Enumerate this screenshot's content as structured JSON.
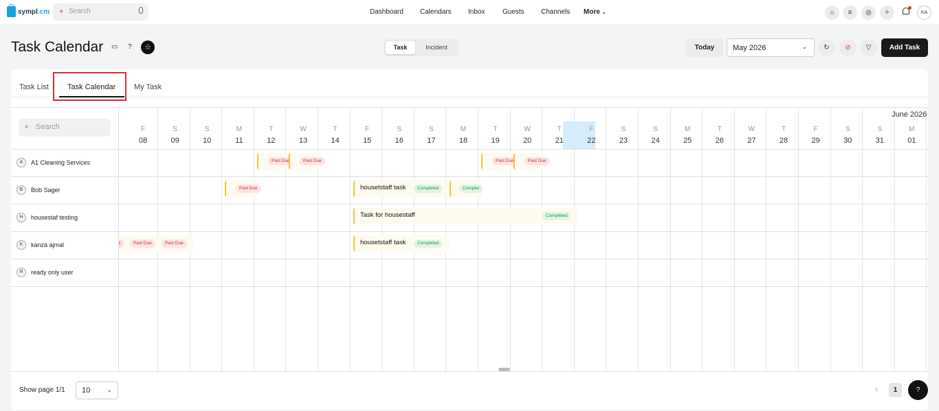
{
  "topbar": {
    "logo_text": "sympl",
    "logo_text2": ".cm",
    "search_placeholder": "Search",
    "nav": [
      "Dashboard",
      "Calendars",
      "Inbox",
      "Guests",
      "Channels",
      "More"
    ],
    "user_initials": "KA"
  },
  "header": {
    "title": "Task Calendar",
    "segments": [
      "Task",
      "Incident"
    ],
    "today_label": "Today",
    "month_value": "May 2026",
    "add_task_label": "Add Task"
  },
  "tabs": [
    "Task List",
    "Task Calendar",
    "My Task"
  ],
  "grid": {
    "search_placeholder": "Search",
    "next_month_label": "June 2026",
    "days": [
      {
        "l": "F",
        "n": "08"
      },
      {
        "l": "S",
        "n": "09"
      },
      {
        "l": "S",
        "n": "10"
      },
      {
        "l": "M",
        "n": "11"
      },
      {
        "l": "T",
        "n": "12"
      },
      {
        "l": "W",
        "n": "13"
      },
      {
        "l": "T",
        "n": "14"
      },
      {
        "l": "F",
        "n": "15"
      },
      {
        "l": "S",
        "n": "16"
      },
      {
        "l": "S",
        "n": "17"
      },
      {
        "l": "M",
        "n": "18"
      },
      {
        "l": "T",
        "n": "19"
      },
      {
        "l": "W",
        "n": "20"
      },
      {
        "l": "T",
        "n": "21"
      },
      {
        "l": "F",
        "n": "22"
      },
      {
        "l": "S",
        "n": "23"
      },
      {
        "l": "S",
        "n": "24"
      },
      {
        "l": "M",
        "n": "25"
      },
      {
        "l": "T",
        "n": "26"
      },
      {
        "l": "W",
        "n": "27"
      },
      {
        "l": "T",
        "n": "28"
      },
      {
        "l": "F",
        "n": "29"
      },
      {
        "l": "S",
        "n": "30"
      },
      {
        "l": "S",
        "n": "31"
      },
      {
        "l": "M",
        "n": "01"
      }
    ],
    "people": [
      {
        "initial": "A",
        "name": "A1 Cleaning Services"
      },
      {
        "initial": "B",
        "name": "Bob Sager"
      },
      {
        "initial": "H",
        "name": "housestaf testing"
      },
      {
        "initial": "K",
        "name": "kanza ajmal"
      },
      {
        "initial": "R",
        "name": "ready only user"
      }
    ],
    "tasks": {
      "housetstaff_task": "housetstaff task",
      "task_for_housestaff": "Task for housestaff",
      "past_due": "Past Due",
      "completed": "Completed",
      "partial_past_due": "e",
      "partial_completed": "Complet"
    }
  },
  "footer": {
    "show_page": "Show page 1/1",
    "per_page": "10",
    "page": "1",
    "help": "?"
  }
}
